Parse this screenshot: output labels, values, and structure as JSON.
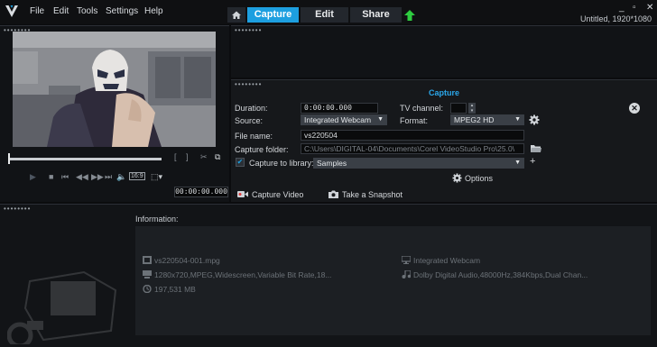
{
  "app": {
    "title": "Untitled, 1920*1080"
  },
  "menu": [
    "File",
    "Edit",
    "Tools",
    "Settings",
    "Help"
  ],
  "tabs": {
    "capture": "Capture",
    "edit": "Edit",
    "share": "Share"
  },
  "window_controls": {
    "minimize": "_",
    "restore": "▫",
    "close": "✕"
  },
  "player": {
    "timecode": "00:00:00.000",
    "aspect_label": "16:9"
  },
  "capture": {
    "title": "Capture",
    "duration_label": "Duration:",
    "duration_value": "0:00:00.000",
    "tv_channel_label": "TV channel:",
    "source_label": "Source:",
    "source_value": "Integrated Webcam",
    "format_label": "Format:",
    "format_value": "MPEG2 HD",
    "filename_label": "File name:",
    "filename_value": "vs220504",
    "folder_label": "Capture folder:",
    "folder_value": "C:\\Users\\DIGITAL-04\\Documents\\Corel VideoStudio Pro\\25.0\\",
    "library_label": "Capture to library:",
    "library_value": "Samples",
    "options_label": "Options",
    "capture_video_label": "Capture Video",
    "snapshot_label": "Take a Snapshot"
  },
  "info": {
    "label": "Information:",
    "file": "vs220504-001.mpg",
    "video_props": "1280x720,MPEG,Widescreen,Variable Bit Rate,18...",
    "size": "197,531 MB",
    "device": "Integrated Webcam",
    "audio_props": "Dolby Digital Audio,48000Hz,384Kbps,Dual Chan..."
  },
  "colors": {
    "accent": "#1d9fe0",
    "upload": "#2ecc40"
  }
}
